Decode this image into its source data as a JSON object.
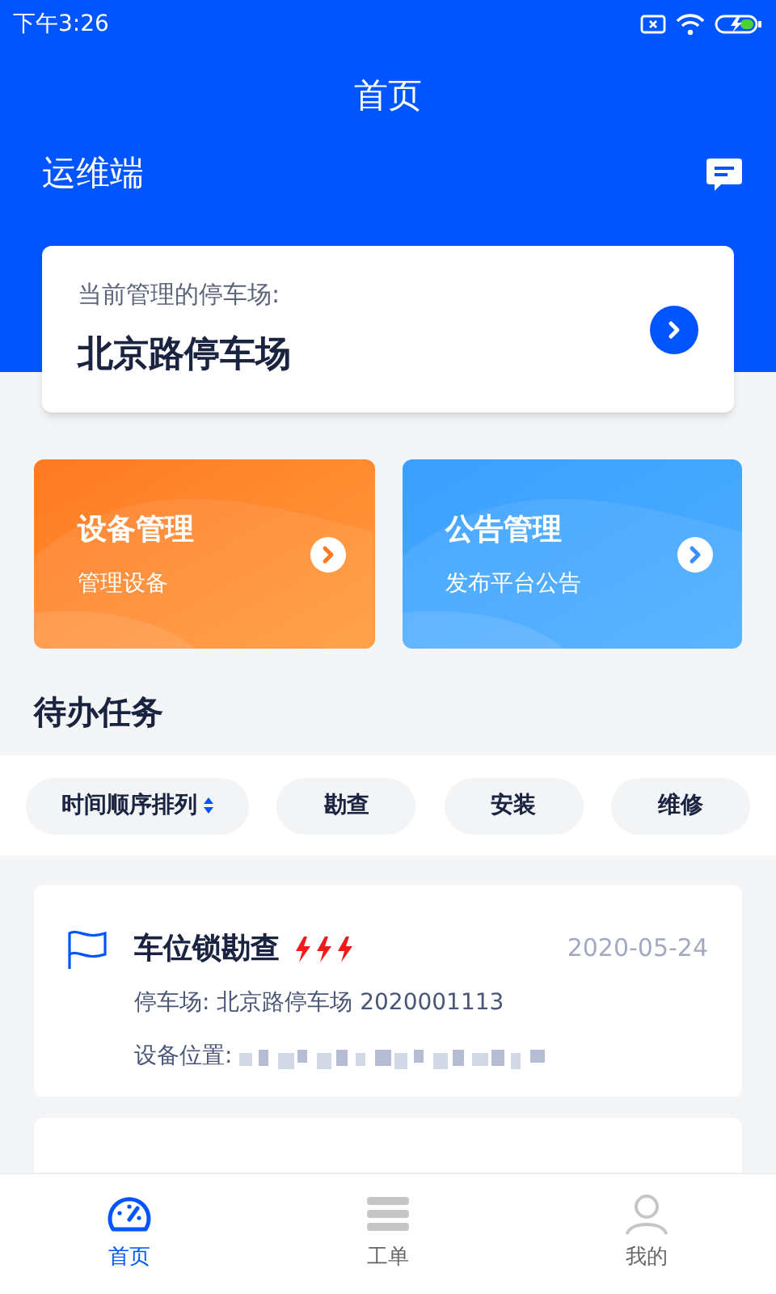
{
  "status_bar": {
    "time": "下午3:26"
  },
  "header": {
    "title": "首页",
    "subtitle": "运维端"
  },
  "parking_card": {
    "label": "当前管理的停车场:",
    "name": "北京路停车场"
  },
  "tiles": [
    {
      "kind": "orange",
      "title": "设备管理",
      "subtitle": "管理设备"
    },
    {
      "kind": "blue",
      "title": "公告管理",
      "subtitle": "发布平台公告"
    }
  ],
  "tasks_heading": "待办任务",
  "filters": [
    {
      "label": "时间顺序排列",
      "kind": "sort"
    },
    {
      "label": "勘查",
      "kind": "plain"
    },
    {
      "label": "安装",
      "kind": "plain"
    },
    {
      "label": "维修",
      "kind": "plain"
    }
  ],
  "tasks": [
    {
      "title": "车位锁勘查",
      "stars": 3,
      "date": "2020-05-24",
      "parking": "停车场: 北京路停车场 2020001113",
      "location_label": "设备位置:"
    }
  ],
  "tab_bar": [
    {
      "label": "首页",
      "selected": true
    },
    {
      "label": "工单",
      "selected": false
    },
    {
      "label": "我的",
      "selected": false
    }
  ]
}
